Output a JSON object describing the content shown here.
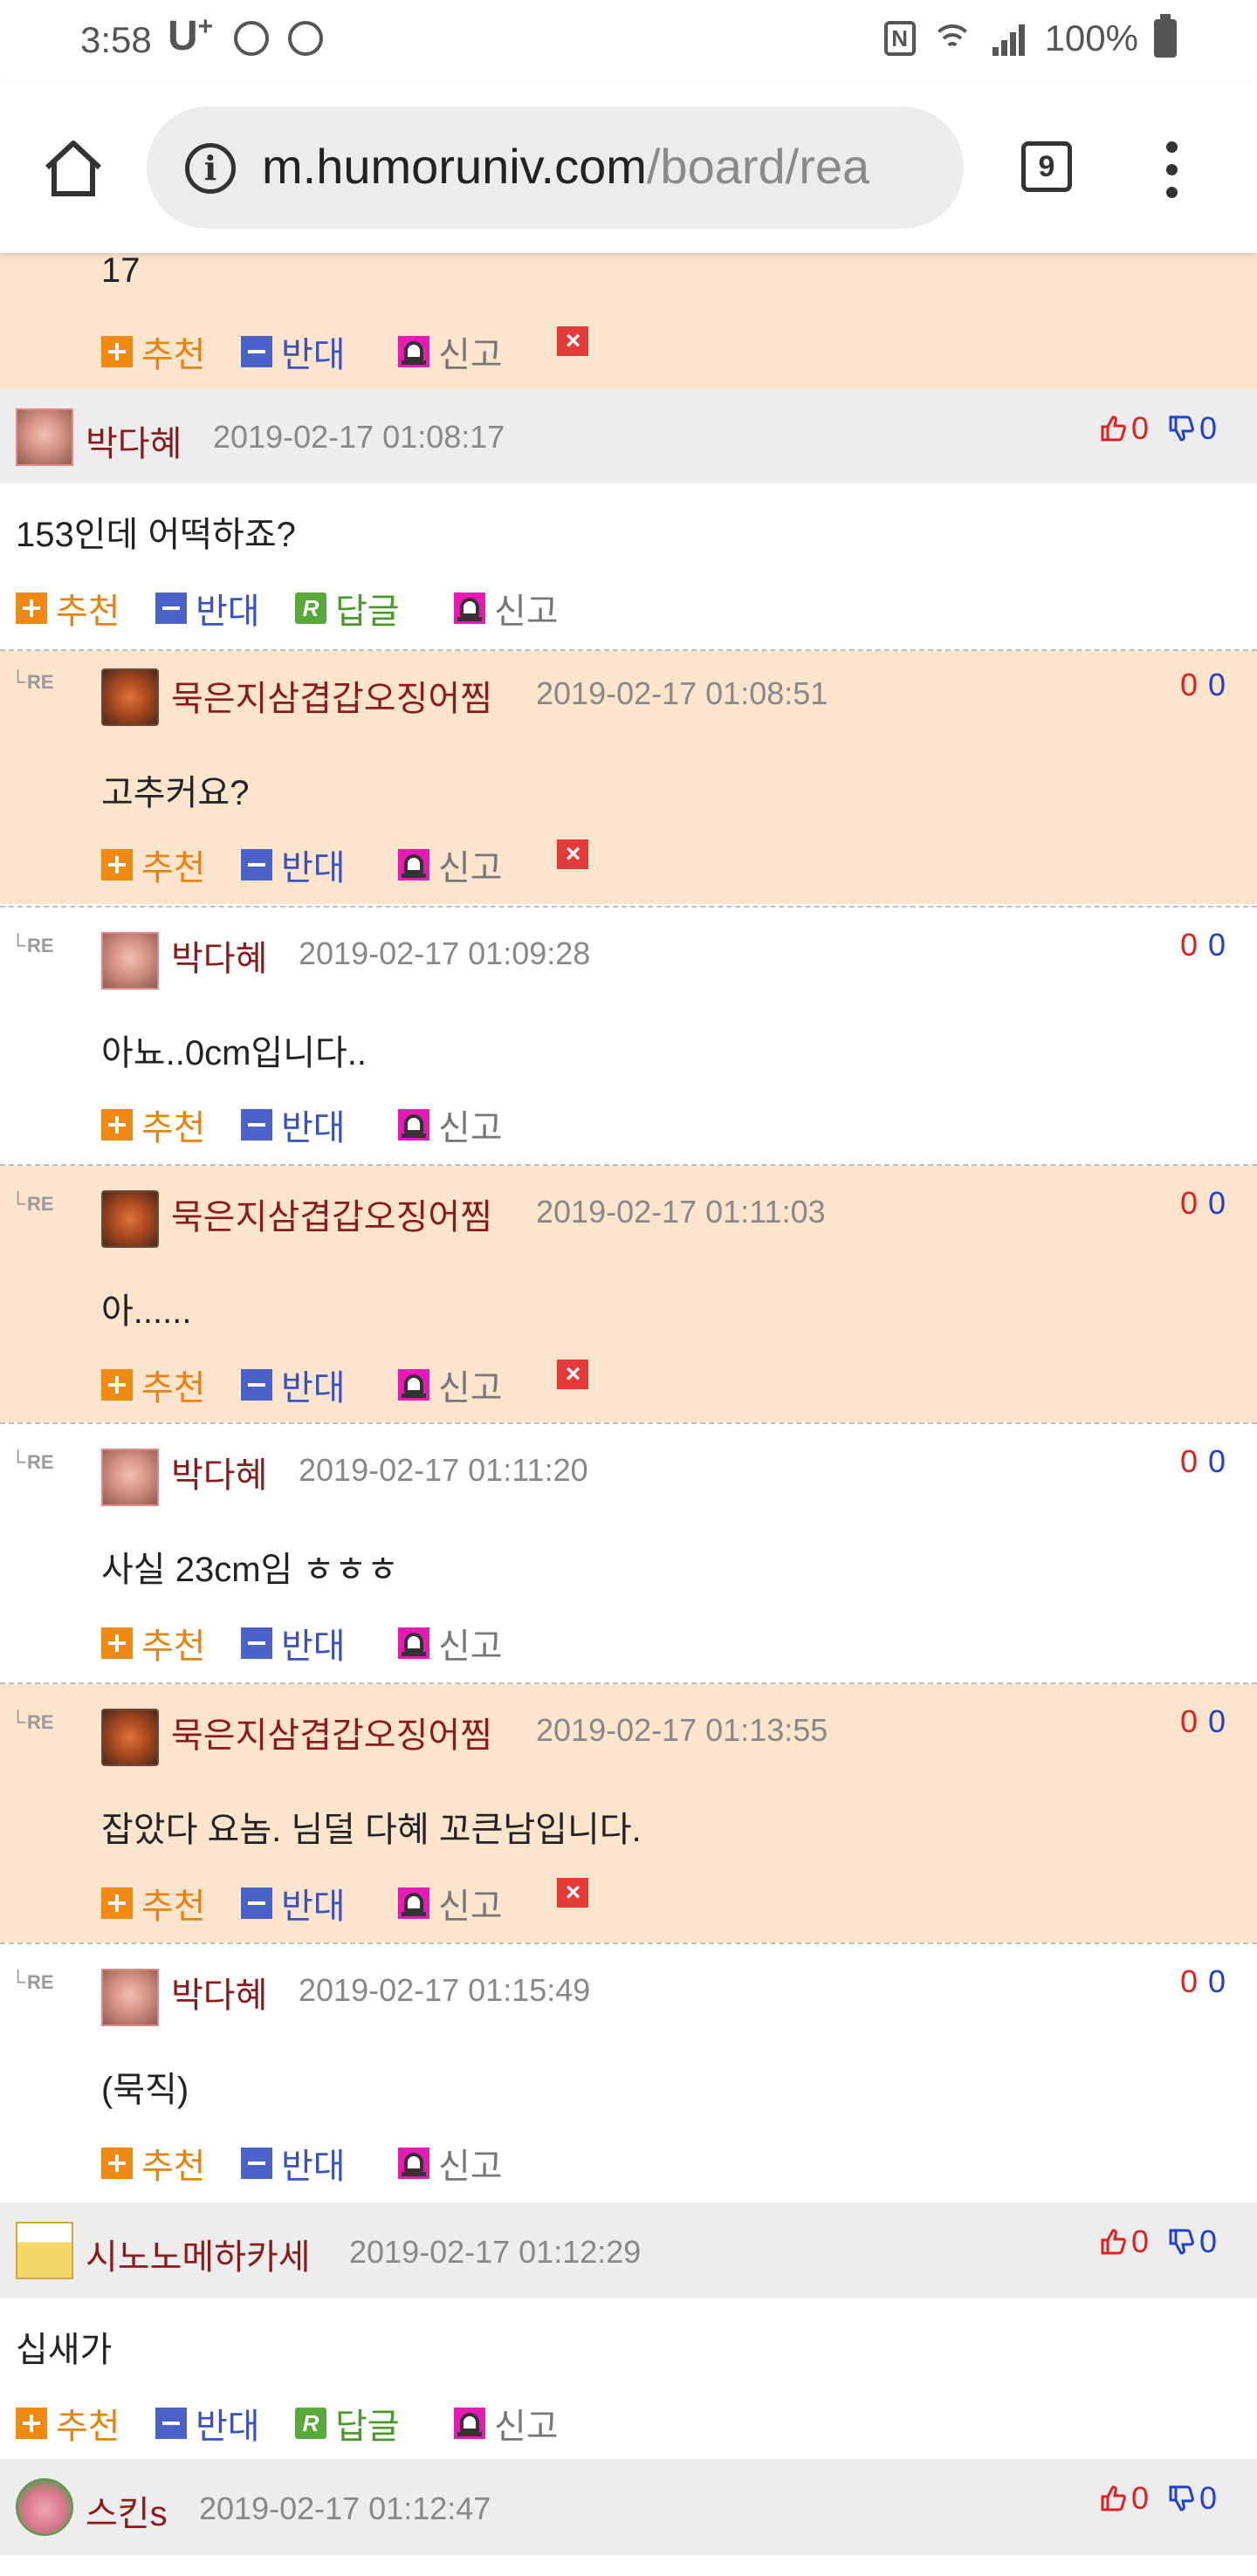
{
  "status_bar": {
    "time": "3:58",
    "carrier": "U",
    "carrier_sup": "+",
    "battery": "100%"
  },
  "browser": {
    "url_host": "m.humoruniv.com",
    "url_path": "/board/rea",
    "tab_count": "9"
  },
  "actions": {
    "recommend": "추천",
    "oppose": "반대",
    "reply": "답글",
    "report": "신고",
    "delete": "×",
    "re": "RE"
  },
  "comments": [
    {
      "body": "17"
    },
    {
      "nick": "박다혜",
      "date": "2019-02-17 01:08:17",
      "body": "153인데 어떡하죠?",
      "up": "0",
      "down": "0"
    },
    {
      "nick": "묵은지삼겹갑오징어찜",
      "date": "2019-02-17 01:08:51",
      "body": "고추커요?",
      "up": "0",
      "down": "0"
    },
    {
      "nick": "박다혜",
      "date": "2019-02-17 01:09:28",
      "body": "아뇨..0cm입니다..",
      "up": "0",
      "down": "0"
    },
    {
      "nick": "묵은지삼겹갑오징어찜",
      "date": "2019-02-17 01:11:03",
      "body": "아......",
      "up": "0",
      "down": "0"
    },
    {
      "nick": "박다혜",
      "date": "2019-02-17 01:11:20",
      "body": "사실 23cm임 ㅎㅎㅎ",
      "up": "0",
      "down": "0"
    },
    {
      "nick": "묵은지삼겹갑오징어찜",
      "date": "2019-02-17 01:13:55",
      "body": "잡았다 요놈. 님덜 다혜 꼬큰남입니다.",
      "up": "0",
      "down": "0"
    },
    {
      "nick": "박다혜",
      "date": "2019-02-17 01:15:49",
      "body": "(묵직)",
      "up": "0",
      "down": "0"
    },
    {
      "nick": "시노노메하카세",
      "date": "2019-02-17 01:12:29",
      "body": "십새가",
      "up": "0",
      "down": "0"
    },
    {
      "nick": "스킨s",
      "date": "2019-02-17 01:12:47",
      "up": "0",
      "down": "0"
    }
  ]
}
